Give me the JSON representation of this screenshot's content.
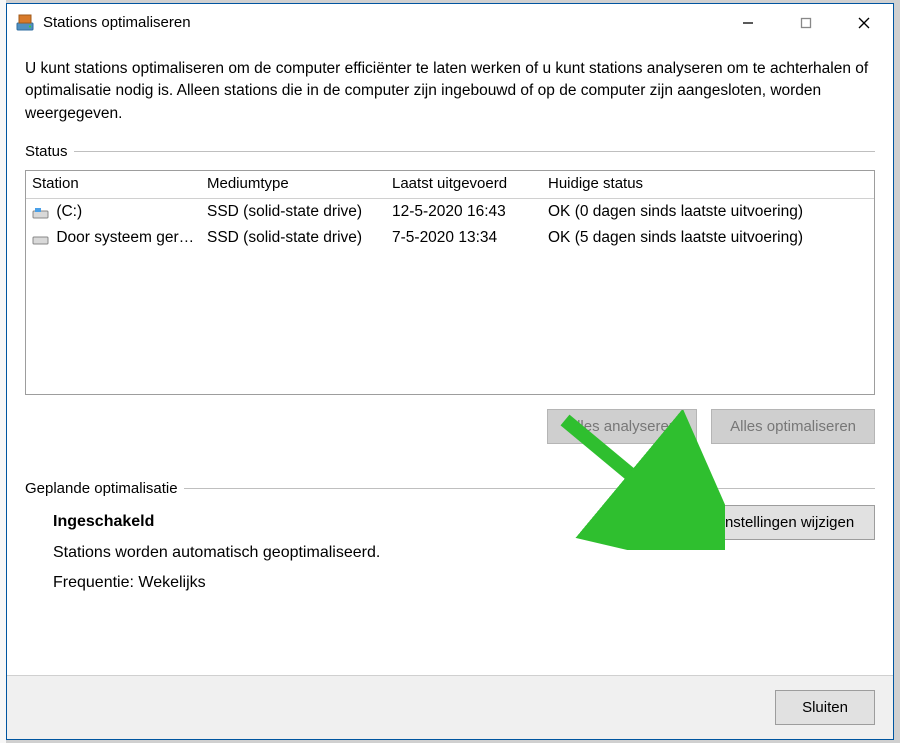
{
  "window": {
    "title": "Stations optimaliseren"
  },
  "intro": "U kunt stations optimaliseren om de computer efficiënter te laten werken of u kunt stations analyseren om te achterhalen of optimalisatie nodig is. Alleen stations die in de computer zijn ingebouwd of op de computer zijn aangesloten, worden weergegeven.",
  "status_label": "Status",
  "columns": {
    "station": "Station",
    "medium": "Mediumtype",
    "last": "Laatst uitgevoerd",
    "status": "Huidige status"
  },
  "rows": [
    {
      "station": "(C:)",
      "medium": "SSD (solid-state drive)",
      "last": "12-5-2020 16:43",
      "status": "OK (0 dagen sinds laatste uitvoering)"
    },
    {
      "station": "Door systeem ger…",
      "medium": "SSD (solid-state drive)",
      "last": "7-5-2020 13:34",
      "status": "OK (5 dagen sinds laatste uitvoering)"
    }
  ],
  "buttons": {
    "analyze_all": "Alles analyseren",
    "optimize_all": "Alles optimaliseren",
    "change_settings": "Instellingen wijzigen",
    "close": "Sluiten"
  },
  "schedule": {
    "heading": "Geplande optimalisatie",
    "enabled": "Ingeschakeld",
    "desc": "Stations worden automatisch geoptimaliseerd.",
    "freq": "Frequentie: Wekelijks"
  }
}
